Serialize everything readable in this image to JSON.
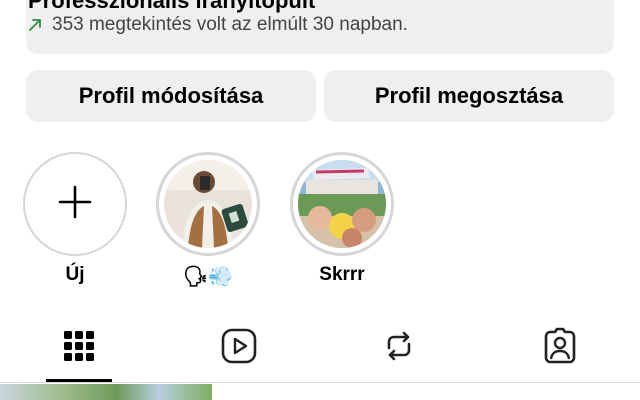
{
  "dashboard": {
    "title": "Professzionális irányítópult",
    "stat_text": "353 megtekintés volt az elmúlt 30 napban.",
    "arrow_icon": "trend-up-arrow-icon",
    "arrow_color": "#2f8a3c"
  },
  "buttons": {
    "edit_profile": "Profil módosítása",
    "share_profile": "Profil megosztása"
  },
  "highlights": [
    {
      "label": "Új",
      "icon": "plus-icon"
    },
    {
      "label": "🗣💨"
    },
    {
      "label": "Skrrr"
    }
  ],
  "tabs": [
    {
      "name": "grid",
      "icon": "grid-icon",
      "active": true
    },
    {
      "name": "reels",
      "icon": "reels-play-icon",
      "active": false
    },
    {
      "name": "reposts",
      "icon": "repost-icon",
      "active": false
    },
    {
      "name": "tagged",
      "icon": "tagged-person-icon",
      "active": false
    }
  ]
}
